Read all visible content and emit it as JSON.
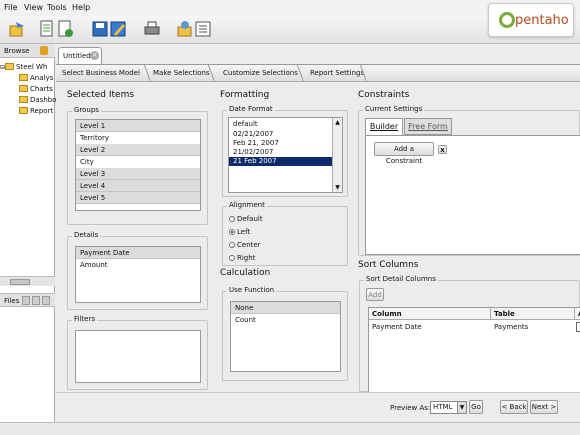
{
  "menubar": {
    "items": [
      "File",
      "View",
      "Tools",
      "Help"
    ]
  },
  "logo": {
    "text": "pentaho"
  },
  "toolbar": {
    "icons": [
      "new-report-icon",
      "open-icon",
      "save-icon",
      "edit-icon",
      "print-icon",
      "publish-icon",
      "properties-icon"
    ]
  },
  "left": {
    "browse_label": "Browse",
    "tree": [
      "Steel Wh",
      "Analys",
      "Charts",
      "Dashbo",
      "Report"
    ],
    "files_label": "Files"
  },
  "tab": {
    "label": "Untitled"
  },
  "steps": [
    "Select Business Model",
    "Make Selections",
    "Customize Selections",
    "Report Settings"
  ],
  "selected_items": {
    "title": "Selected Items",
    "groups_label": "Groups",
    "groups": [
      "Level 1",
      "Territory",
      "Level 2",
      "City",
      "Level 3",
      "Level 4",
      "Level 5"
    ],
    "details_label": "Details",
    "details": [
      "Payment Date",
      "Amount"
    ],
    "filters_label": "Filters"
  },
  "formatting": {
    "title": "Formatting",
    "date_format_label": "Date Format",
    "date_formats": [
      "default",
      "02/21/2007",
      "Feb 21, 2007",
      "21/02/2007",
      "21 Feb 2007"
    ],
    "alignment_label": "Alignment",
    "alignments": [
      "Default",
      "Left",
      "Center",
      "Right"
    ]
  },
  "calculation": {
    "title": "Calculation",
    "use_function_label": "Use Function",
    "functions": [
      "None",
      "Count"
    ]
  },
  "constraints": {
    "title": "Constraints",
    "current_settings_label": "Current Settings",
    "tabs": [
      "Builder",
      "Free Form"
    ],
    "add_constraint_label": "Add a Constraint",
    "remove_label": "x"
  },
  "sort": {
    "title": "Sort Columns",
    "detail_label": "Sort Detail Columns",
    "add_label": "Add",
    "headers": [
      "Column",
      "Table",
      "A"
    ],
    "rows": [
      [
        "Payment Date",
        "Payments"
      ]
    ]
  },
  "bottom": {
    "preview_label": "Preview As:",
    "preview_value": "HTML",
    "go_label": "Go",
    "back_label": "< Back",
    "next_label": "Next >"
  }
}
